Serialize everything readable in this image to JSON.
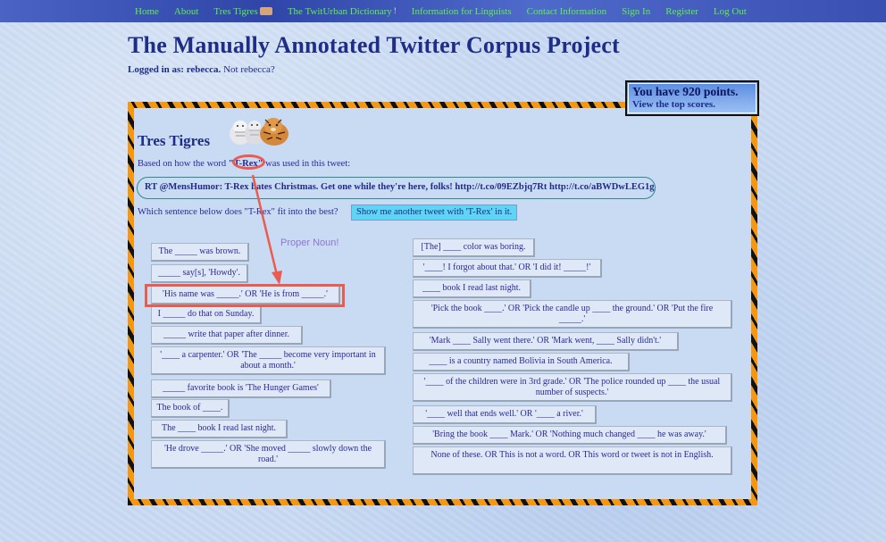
{
  "nav": {
    "items": [
      "Home",
      "About",
      "Tres Tigres",
      "The TwitUrban Dictionary",
      "Information for Linguists",
      "Contact Information",
      "Sign In",
      "Register",
      "Log Out"
    ]
  },
  "header": {
    "title": "The Manually Annotated Twitter Corpus Project",
    "logged_in_prefix": "Logged in as:",
    "username": "rebecca.",
    "not_user": "Not rebecca?"
  },
  "points": {
    "text": "You have 920 points.",
    "link": "View the top scores."
  },
  "game": {
    "title": "Tres Tigres",
    "based_prefix": "Based on how the word ",
    "word": "\"T-Rex\"",
    "based_suffix": " was used in this tweet:",
    "tweet": "RT @MensHumor: T-Rex hates Christmas. Get one while they're here, folks! http://t.co/09EZbjq7Rt http://t.co/aBWDwLEG1g",
    "question": "Which sentence below does \"T-Rex\" fit into the best?",
    "show_another": "Show me another tweet with 'T-Rex' in it."
  },
  "options_left": [
    "The _____ was brown.",
    "_____ say[s], 'Howdy'.",
    "'His name was _____.' OR 'He is from _____.'",
    "I _____ do that on Sunday.",
    "_____ write that paper after dinner.",
    "'____ a carpenter.' OR 'The _____ become very important in about a month.'",
    "_____ favorite book is 'The Hunger Games'",
    "The book of ____.",
    "The ____ book I read last night.",
    "'He drove _____.' OR 'She moved _____ slowly down the road.'"
  ],
  "options_right": [
    "[The] ____ color was boring.",
    "'____! I forgot about that.' OR 'I did it! _____!'",
    "____ book I read last night.",
    "'Pick the book ____.' OR 'Pick the candle up ____ the ground.' OR 'Put the fire _____.'",
    "'Mark ____ Sally went there.' OR 'Mark went, ____ Sally didn't.'",
    "____ is a country named Bolivia in South America.",
    "'____ of the children were in 3rd grade.' OR 'The police rounded up ____ the usual number of suspects.'",
    "'____ well that ends well.' OR '____ a river.'",
    "'Bring the book ____ Mark.' OR 'Nothing much changed ____ he was away.'",
    "None of these. OR This is not a word. OR This word or tweet is not in English."
  ],
  "annotation": {
    "label": "Proper Noun!",
    "color": "#e95c4f"
  },
  "colors": {
    "nav_link": "#5cf04a",
    "title": "#1e2c8a",
    "border_orange": "#f59810"
  }
}
